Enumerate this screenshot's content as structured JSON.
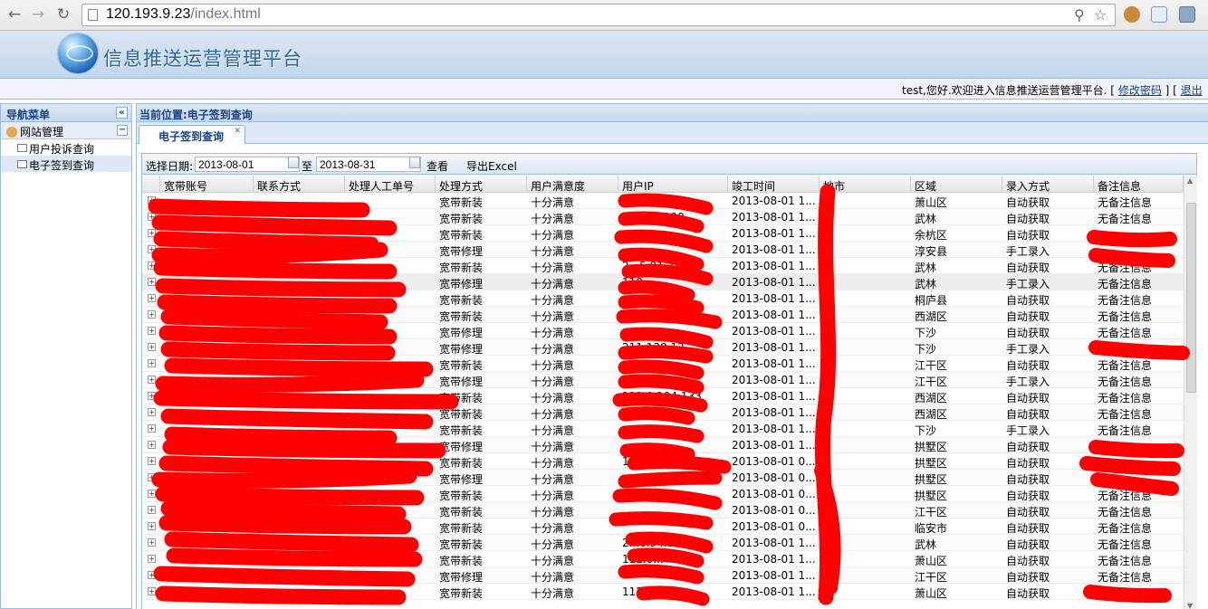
{
  "browser": {
    "url_host": "120.193.9.23",
    "url_path": "/index.html",
    "back_icon": "arrow-left-icon",
    "forward_icon": "arrow-right-icon",
    "reload_icon": "reload-icon"
  },
  "header": {
    "app_title": "信息推送运营管理平台",
    "welcome_prefix": "test,您好.欢迎进入信息推送运营管理平台.  [ ",
    "change_password": "修改密码",
    "welcome_mid": " ]  [ ",
    "logout": "退出"
  },
  "sidebar": {
    "title": "导航菜单",
    "collapse_glyph": "«",
    "group_label": "网站管理",
    "group_toggle": "−",
    "items": [
      {
        "label": "用户投诉查询"
      },
      {
        "label": "电子签到查询"
      }
    ]
  },
  "main": {
    "location_label": "当前位置:电子签到查询",
    "tab_label": "电子签到查询",
    "tab_close": "✕"
  },
  "toolbar": {
    "date_label": "选择日期:",
    "start_date": "2013-08-01",
    "to_label": "至",
    "end_date": "2013-08-31",
    "query_label": "查看",
    "export_label": "导出Excel"
  },
  "grid": {
    "columns": [
      "宽带账号",
      "联系方式",
      "处理人工单号",
      "处理方式",
      "用户满意度",
      "用户IP",
      "竣工时间",
      "地市",
      "区域",
      "录入方式",
      "备注信息"
    ],
    "rows": [
      {
        "type": "宽带新装",
        "sat": "十分满意",
        "ip": "",
        "time": "2013-08-01 1...",
        "area": "萧山区",
        "entry": "自动获取",
        "note": "无备注信息"
      },
      {
        "type": "宽带新装",
        "sat": "十分满意",
        "ip": "2..5.89.190",
        "time": "2013-08-01 1...",
        "area": "武林",
        "entry": "自动获取",
        "note": "无备注信息"
      },
      {
        "type": "宽带新装",
        "sat": "十分满意",
        "ip": "",
        "time": "2013-08-01 1...",
        "area": "余杭区",
        "entry": "自动获取",
        "note": ""
      },
      {
        "type": "宽带修理",
        "sat": "十分满意",
        "ip": "",
        "time": "2013-08-01 1...",
        "area": "淳安县",
        "entry": "手工录入",
        "note": ""
      },
      {
        "type": "宽带新装",
        "sat": "十分满意",
        "ip": "2...5.91.242",
        "time": "2013-08-01 1...",
        "area": "武林",
        "entry": "自动获取",
        "note": "无备注信息"
      },
      {
        "type": "宽带修理",
        "sat": "十分满意",
        "ip": "110...",
        "time": "2013-08-01 1...",
        "area": "武林",
        "entry": "手工录入",
        "note": "无备注信息",
        "hl": true
      },
      {
        "type": "宽带新装",
        "sat": "十分满意",
        "ip": "",
        "time": "2013-08-01 1...",
        "area": "桐庐县",
        "entry": "自动获取",
        "note": "无备注信息"
      },
      {
        "type": "宽带新装",
        "sat": "十分满意",
        "ip": "",
        "time": "2013-08-01 1...",
        "area": "西湖区",
        "entry": "自动获取",
        "note": "无备注信息"
      },
      {
        "type": "宽带修理",
        "sat": "十分满意",
        "ip": "",
        "time": "2013-08-01 1...",
        "area": "下沙",
        "entry": "自动获取",
        "note": "无备注信息"
      },
      {
        "type": "宽带修理",
        "sat": "十分满意",
        "ip": "211.138.12...",
        "time": "2013-08-01 1...",
        "area": "下沙",
        "entry": "手工录入",
        "note": ""
      },
      {
        "type": "宽带新装",
        "sat": "十分满意",
        "ip": "",
        "time": "2013-08-01 1...",
        "area": "江干区",
        "entry": "自动获取",
        "note": "无备注信息"
      },
      {
        "type": "宽带修理",
        "sat": "十分满意",
        "ip": "",
        "time": "2013-08-01 1...",
        "area": "江干区",
        "entry": "手工录入",
        "note": "无备注信息"
      },
      {
        "type": "宽带新装",
        "sat": "十分满意",
        "ip": "111.0.104.133",
        "time": "2013-08-01 1...",
        "area": "西湖区",
        "entry": "自动获取",
        "note": "无备注信息"
      },
      {
        "type": "宽带新装",
        "sat": "十分满意",
        "ip": "223.93...",
        "time": "2013-08-01 1...",
        "area": "西湖区",
        "entry": "自动获取",
        "note": "无备注信息"
      },
      {
        "type": "宽带新装",
        "sat": "十分满意",
        "ip": "",
        "time": "2013-08-01 1...",
        "area": "下沙",
        "entry": "手工录入",
        "note": "无备注信息"
      },
      {
        "type": "宽带修理",
        "sat": "十分满意",
        "ip": "",
        "time": "2013-08-01 1...",
        "area": "拱墅区",
        "entry": "自动获取",
        "note": ""
      },
      {
        "type": "宽带新装",
        "sat": "十分满意",
        "ip": "11...",
        "time": "2013-08-01 0...",
        "area": "拱墅区",
        "entry": "自动获取",
        "note": ""
      },
      {
        "type": "宽带修理",
        "sat": "十分满意",
        "ip": "",
        "time": "2013-08-01 0...",
        "area": "拱墅区",
        "entry": "自动获取",
        "note": ""
      },
      {
        "type": "宽带新装",
        "sat": "十分满意",
        "ip": "",
        "time": "2013-08-01 0...",
        "area": "拱墅区",
        "entry": "自动获取",
        "note": "无备注信息"
      },
      {
        "type": "宽带新装",
        "sat": "十分满意",
        "ip": "",
        "time": "2013-08-01 0...",
        "area": "江干区",
        "entry": "自动获取",
        "note": "无备注信息"
      },
      {
        "type": "宽带新装",
        "sat": "十分满意",
        "ip": "",
        "time": "2013-08-01 0...",
        "area": "临安市",
        "entry": "自动获取",
        "note": "无备注信息"
      },
      {
        "type": "宽带新装",
        "sat": "十分满意",
        "ip": "2...6.94.138",
        "time": "2013-08-01 1...",
        "area": "武林",
        "entry": "自动获取",
        "note": "无备注信息"
      },
      {
        "type": "宽带新装",
        "sat": "十分满意",
        "ip": "111.0...",
        "time": "2013-08-01 1...",
        "area": "萧山区",
        "entry": "自动获取",
        "note": "无备注信息"
      },
      {
        "type": "宽带修理",
        "sat": "十分满意",
        "ip": "",
        "time": "2013-08-01 1...",
        "area": "江干区",
        "entry": "自动获取",
        "note": "无备注信息"
      },
      {
        "type": "宽带新装",
        "sat": "十分满意",
        "ip": "112...",
        "time": "2013-08-01 1...",
        "area": "萧山区",
        "entry": "自动获取",
        "note": ""
      }
    ]
  },
  "colors": {
    "border_blue": "#99bbe8",
    "header_text": "#15428b",
    "redaction": "#ff0000"
  }
}
